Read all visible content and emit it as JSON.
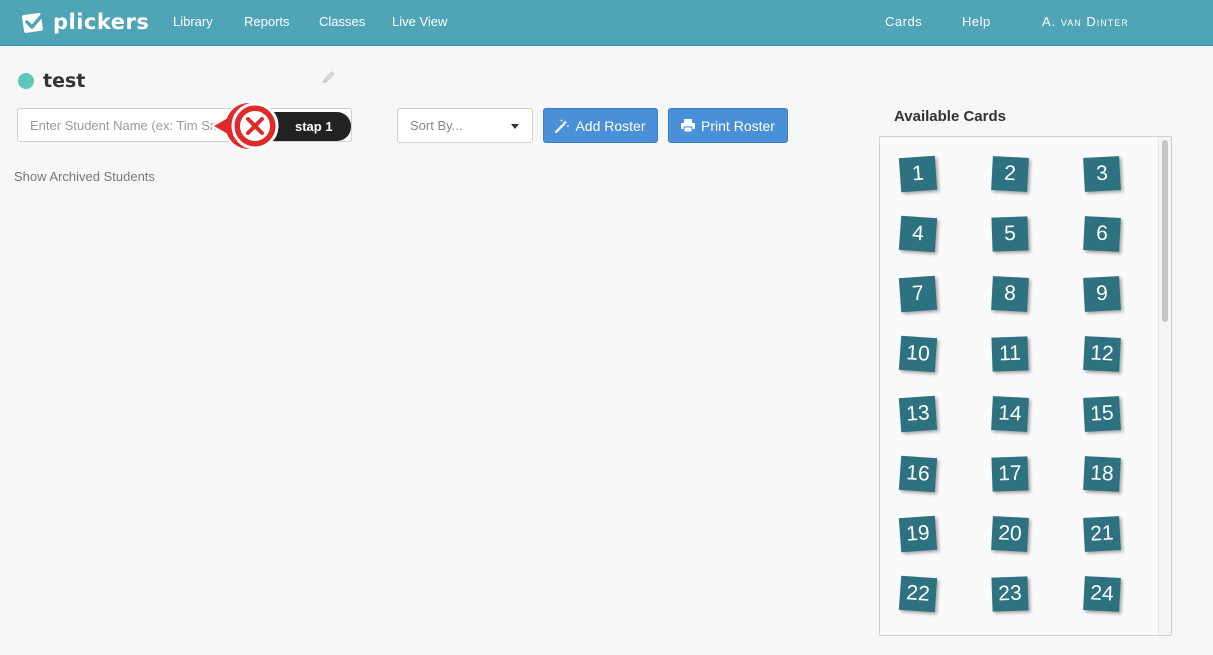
{
  "nav": {
    "brand": "plickers",
    "items": [
      "Library",
      "Reports",
      "Classes",
      "Live View"
    ],
    "right_items": [
      "Cards",
      "Help"
    ],
    "user": "A. van Dinter"
  },
  "class": {
    "name": "test",
    "dot_color": "#5bc8b8"
  },
  "roster": {
    "student_placeholder": "Enter Student Name (ex: Tim Smith)",
    "sort_label": "Sort By...",
    "add_roster_label": "Add Roster",
    "print_roster_label": "Print Roster",
    "show_archived_label": "Show Archived Students"
  },
  "annotation": {
    "step_label": "stap 1"
  },
  "available_cards": {
    "heading": "Available Cards",
    "cards": [
      "1",
      "2",
      "3",
      "4",
      "5",
      "6",
      "7",
      "8",
      "9",
      "10",
      "11",
      "12",
      "13",
      "14",
      "15",
      "16",
      "17",
      "18",
      "19",
      "20",
      "21",
      "22",
      "23",
      "24"
    ]
  },
  "colors": {
    "navbar": "#4fa5b5",
    "button_primary": "#4a90d9",
    "card": "#2e7180",
    "callout_red": "#e02a2a"
  }
}
